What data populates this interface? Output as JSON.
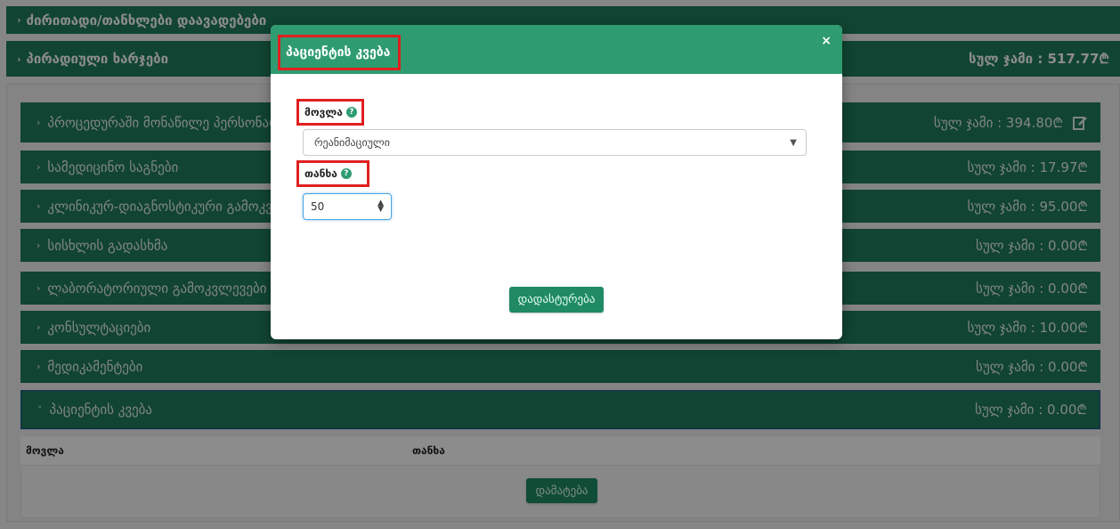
{
  "background": {
    "section_title": "ძირითადი/თანხლები დაავადებები",
    "expenses_bar": {
      "label": "პირადიული ხარჯები",
      "total": "სულ ჯამი : 517.77₾"
    },
    "rows": [
      {
        "label": "პროცედურაში მონაწილე პერსონალ",
        "total": "სულ ჯამი : 394.80₾",
        "icon": "edit-icon"
      },
      {
        "label": "სამედიცინო საგნები",
        "total": "სულ ჯამი : 17.97₾"
      },
      {
        "label": "კლინიკურ-დიაგნოსტიკური გამოკვლ",
        "total": "სულ ჯამი : 95.00₾"
      },
      {
        "label": "სისხლის გადასხმა",
        "total": "სულ ჯამი : 0.00₾"
      },
      {
        "label": "ლაბორატორიული გამოკვლევები",
        "total": "სულ ჯამი : 0.00₾"
      },
      {
        "label": "კონსულტაციები",
        "total": "სულ ჯამი : 10.00₾"
      },
      {
        "label": "მედიკამენტები",
        "total": "სულ ჯამი : 0.00₾"
      },
      {
        "label": "პაციენტის კვება",
        "total": "სულ ჯამი : 0.00₾"
      }
    ],
    "table": {
      "col_service": "მოვლა",
      "col_amount": "თანხა"
    },
    "add_button": "დამატება"
  },
  "modal": {
    "title": "პაციენტის კვება",
    "close_label": "×",
    "service_label": "მოვლა",
    "service_value": "რეანიმაციული",
    "amount_label": "თანხა",
    "amount_value": "50",
    "confirm_button": "დადასტურება"
  },
  "colors": {
    "accent": "#1f7d5c",
    "modal_header": "#2e9c70",
    "highlight": "#e02020"
  }
}
